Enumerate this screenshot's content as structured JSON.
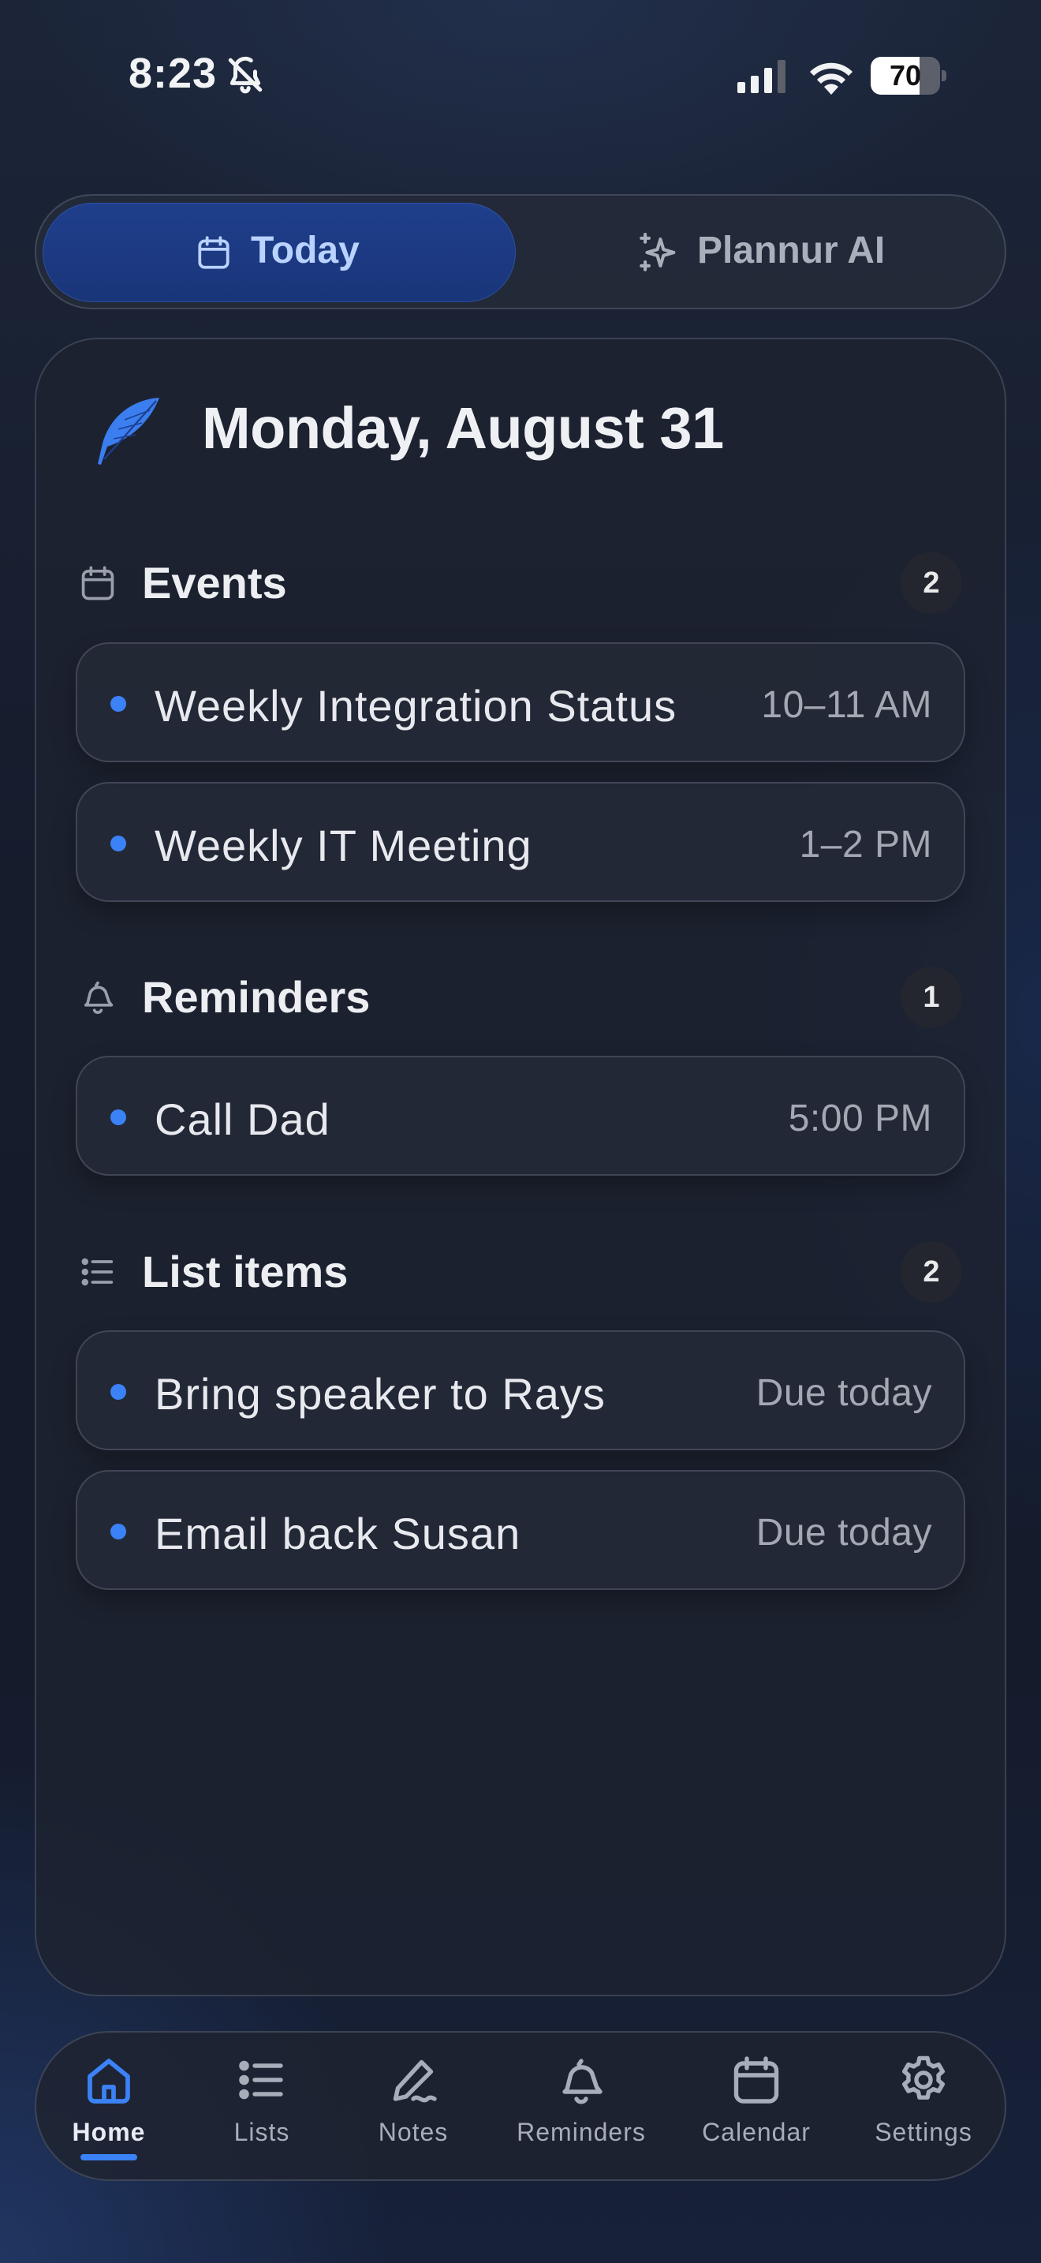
{
  "status_bar": {
    "time": "8:23",
    "battery_percent": 70
  },
  "segmented": {
    "today_label": "Today",
    "ai_label": "Plannur AI"
  },
  "header": {
    "date": "Monday, August 31"
  },
  "sections": {
    "events": {
      "title": "Events",
      "count": "2",
      "items": [
        {
          "title": "Weekly Integration Status",
          "meta": "10–11 AM"
        },
        {
          "title": "Weekly IT Meeting",
          "meta": "1–2 PM"
        }
      ]
    },
    "reminders": {
      "title": "Reminders",
      "count": "1",
      "items": [
        {
          "title": "Call Dad",
          "meta": "5:00 PM"
        }
      ]
    },
    "lists": {
      "title": "List items",
      "count": "2",
      "items": [
        {
          "title": "Bring speaker to Rays",
          "meta": "Due today"
        },
        {
          "title": "Email back Susan",
          "meta": "Due today"
        }
      ]
    }
  },
  "tabbar": {
    "tabs": [
      {
        "label": "Home",
        "icon": "home-icon",
        "active": true
      },
      {
        "label": "Lists",
        "icon": "list-icon"
      },
      {
        "label": "Notes",
        "icon": "pen-icon"
      },
      {
        "label": "Reminders",
        "icon": "bell-icon"
      },
      {
        "label": "Calendar",
        "icon": "calendar-icon"
      },
      {
        "label": "Settings",
        "icon": "gear-icon"
      }
    ]
  },
  "colors": {
    "accent": "#3b82f6",
    "active_segment": "#1f3f8c",
    "background": "#151c2c"
  }
}
